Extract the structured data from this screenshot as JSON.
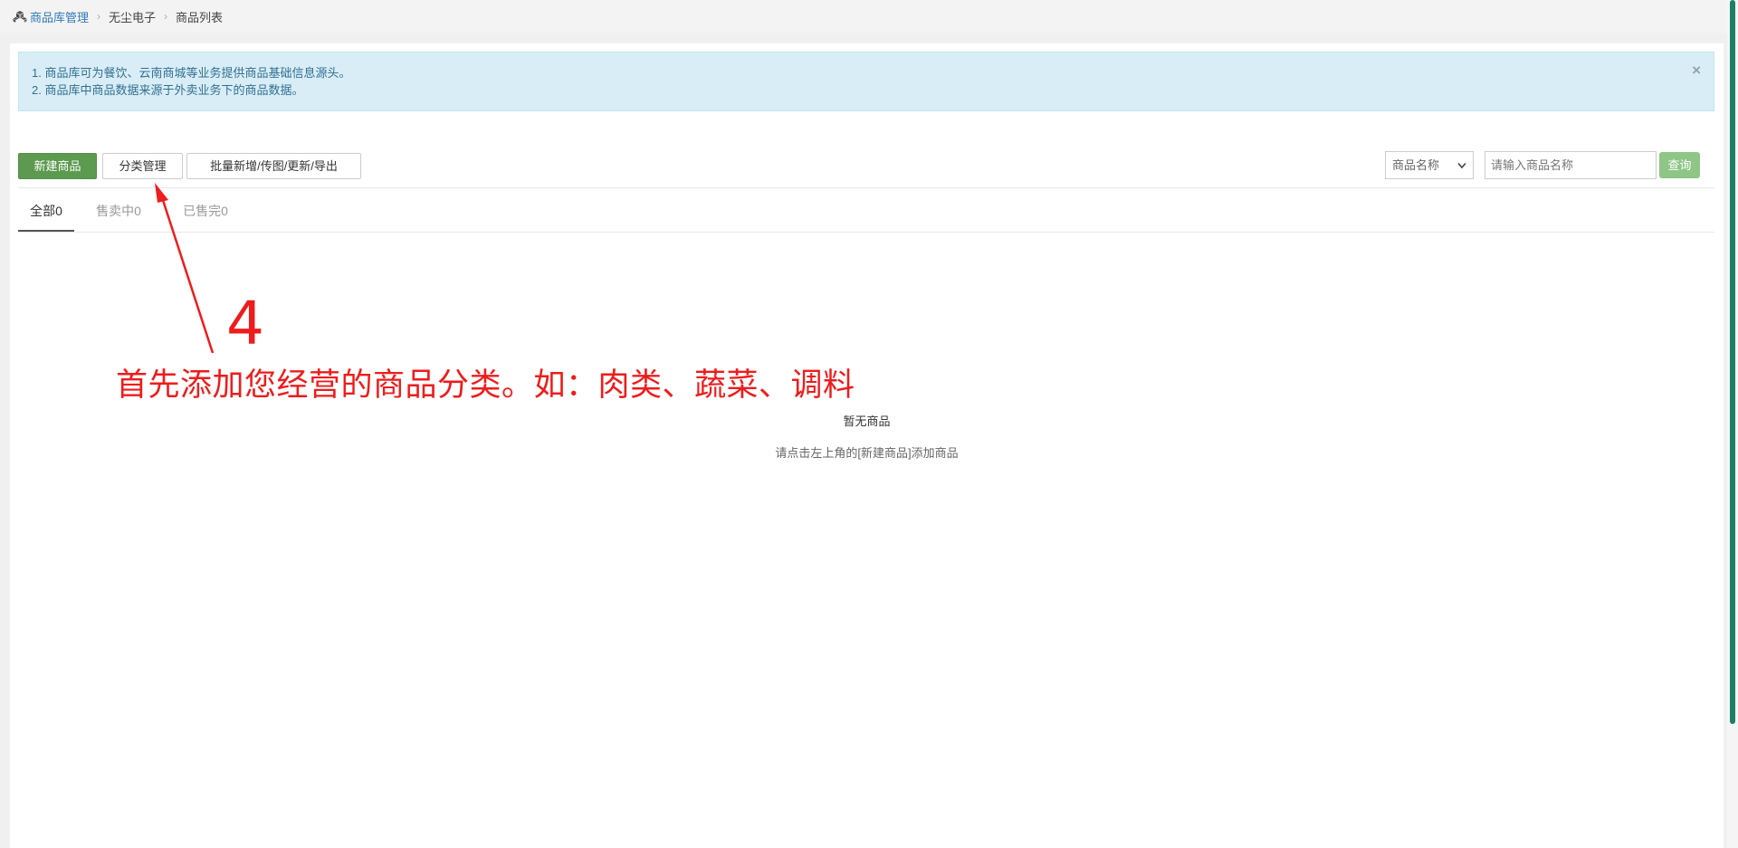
{
  "breadcrumb": {
    "items": [
      {
        "label": "商品库管理"
      },
      {
        "label": "无尘电子"
      },
      {
        "label": "商品列表"
      }
    ]
  },
  "alert": {
    "lines": [
      "1. 商品库可为餐饮、云南商城等业务提供商品基础信息源头。",
      "2. 商品库中商品数据来源于外卖业务下的商品数据。"
    ],
    "close": "×"
  },
  "toolbar": {
    "new_label": "新建商品",
    "category_label": "分类管理",
    "batch_label": "批量新增/传图/更新/导出"
  },
  "search": {
    "select_value": "商品名称",
    "placeholder": "请输入商品名称",
    "query_label": "查询"
  },
  "tabs": [
    {
      "label": "全部0",
      "active": true
    },
    {
      "label": "售卖中0",
      "active": false
    },
    {
      "label": "已售完0",
      "active": false
    }
  ],
  "empty": {
    "title": "暂无商品",
    "hint": "请点击左上角的[新建商品]添加商品"
  },
  "annotation": {
    "step": "4",
    "text": "首先添加您经营的商品分类。如：肉类、蔬菜、调料",
    "color": "#ee1c1c"
  },
  "colors": {
    "primary_green": "#5c9a4f",
    "query_green": "#8fc587",
    "alert_bg": "#d9edf7",
    "alert_text": "#31708f",
    "link": "#2f7ab8"
  }
}
